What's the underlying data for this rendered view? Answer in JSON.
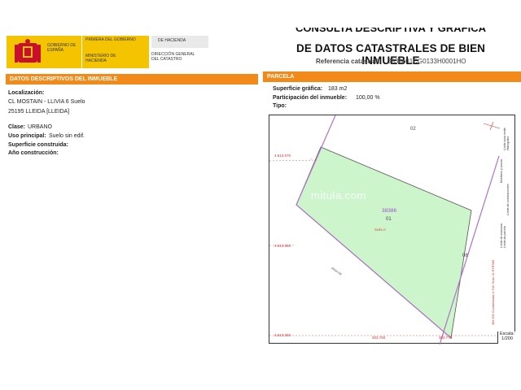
{
  "header": {
    "gobierno": "GOBIERNO DE ESPAÑA",
    "ministerio": "MINISTERIO DE HACIENDA",
    "primera": "PRIMERA DEL GOBIERNO",
    "de_hacienda": "DE HACIENDA",
    "direccion": "DIRECCIÓN GENERAL DEL CATASTRO",
    "doc_title_top": "CONSULTA DESCRIPTIVA Y GRÁFICA",
    "doc_title": "DE DATOS CATASTRALES DE BIEN INMUEBLE",
    "ref_label": "Referencia catastral:",
    "ref_value": "3838601CG0133H0001HO",
    "colors": {
      "accent": "#f28a1a",
      "yellow": "#f5c400"
    }
  },
  "inmueble": {
    "section_title": "DATOS DESCRIPTIVOS DEL INMUEBLE",
    "localizacion_label": "Localización:",
    "localizacion_line1": "CL MOSTAIN - LLIVIA 6 Suelo",
    "localizacion_line2": "25195 LLEIDA [LLEIDA]",
    "clase_label": "Clase:",
    "clase_value": "URBANO",
    "uso_label": "Uso principal:",
    "uso_value": "Suelo sin edif.",
    "superficie_label": "Superficie construida:",
    "anio_label": "Año construcción:"
  },
  "parcela": {
    "section_title": "PARCELA",
    "sup_label": "Superficie gráfica:",
    "sup_value": "183 m2",
    "part_label": "Participación del inmueble:",
    "part_value": "100,00 %",
    "tipo_label": "Tipo:"
  },
  "map": {
    "parcel_ref": "38386",
    "parcel_num": "01",
    "suelo_label": "SUELO",
    "neighbor_02": "02",
    "neighbor_08": "08",
    "coord_y1": "4.613.570",
    "coord_y2": "4.613.560",
    "coord_y3": "4.613.550",
    "coord_x1": "303.760",
    "coord_x2": "303.770",
    "street": "PASA DE",
    "scale_label": "Escala:",
    "scale_value": "1/200",
    "watermark": "mitula.com",
    "legend": [
      "Límite de manzana",
      "Límite de parcela",
      "Límite de construcciones",
      "Mobiliario y aceras",
      "Límite zona verde",
      "Hidrografía"
    ],
    "side_note": "Este documento no es una certificación catastral, pero sus datos pueden ser verificados a través de la Sede Electrónica del Catastro",
    "side_note_red": "383 000 Coordenadas U.T.M. Huso 31 ETRS89",
    "colors": {
      "parcel_fill": "#ccf5cc",
      "boundary": "#b070c8",
      "parcel_text": "#a050d0",
      "suelo": "#d03030"
    }
  }
}
